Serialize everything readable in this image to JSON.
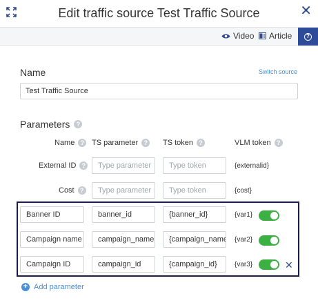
{
  "header": {
    "title": "Edit traffic source Test Traffic Source",
    "expand_icon": "expand-icon",
    "close_icon": "close-icon"
  },
  "toolbar": {
    "video_label": "Video",
    "article_label": "Article",
    "help_icon": "help-icon"
  },
  "name_section": {
    "title": "Name",
    "switch_source": "Switch source",
    "value": "Test Traffic Source"
  },
  "parameters": {
    "title": "Parameters",
    "columns": {
      "name": "Name",
      "ts_parameter": "TS parameter",
      "ts_token": "TS token",
      "vlm_token": "VLM token"
    },
    "fixed_rows": [
      {
        "name": "External ID",
        "ts_parameter_placeholder": "Type parameter",
        "ts_token_placeholder": "Type token",
        "vlm_token": "{externalid}"
      },
      {
        "name": "Cost",
        "ts_parameter_placeholder": "Type parameter",
        "ts_token_placeholder": "Type token",
        "vlm_token": "{cost}"
      }
    ],
    "custom_rows": [
      {
        "name": "Banner ID",
        "ts_parameter": "banner_id",
        "ts_token": "{banner_id}",
        "vlm_token": "{var1}",
        "enabled": true
      },
      {
        "name": "Campaign name",
        "ts_parameter": "campaign_name",
        "ts_token": "{campaign_name}",
        "vlm_token": "{var2}",
        "enabled": true
      },
      {
        "name": "Campaign ID",
        "ts_parameter": "campaign_id",
        "ts_token": "{campaign_id}",
        "vlm_token": "{var3}",
        "enabled": true
      }
    ],
    "add_label": "Add parameter"
  },
  "colors": {
    "accent": "#2d4b99",
    "link": "#4a90d9",
    "toggle_on": "#3cb043"
  }
}
